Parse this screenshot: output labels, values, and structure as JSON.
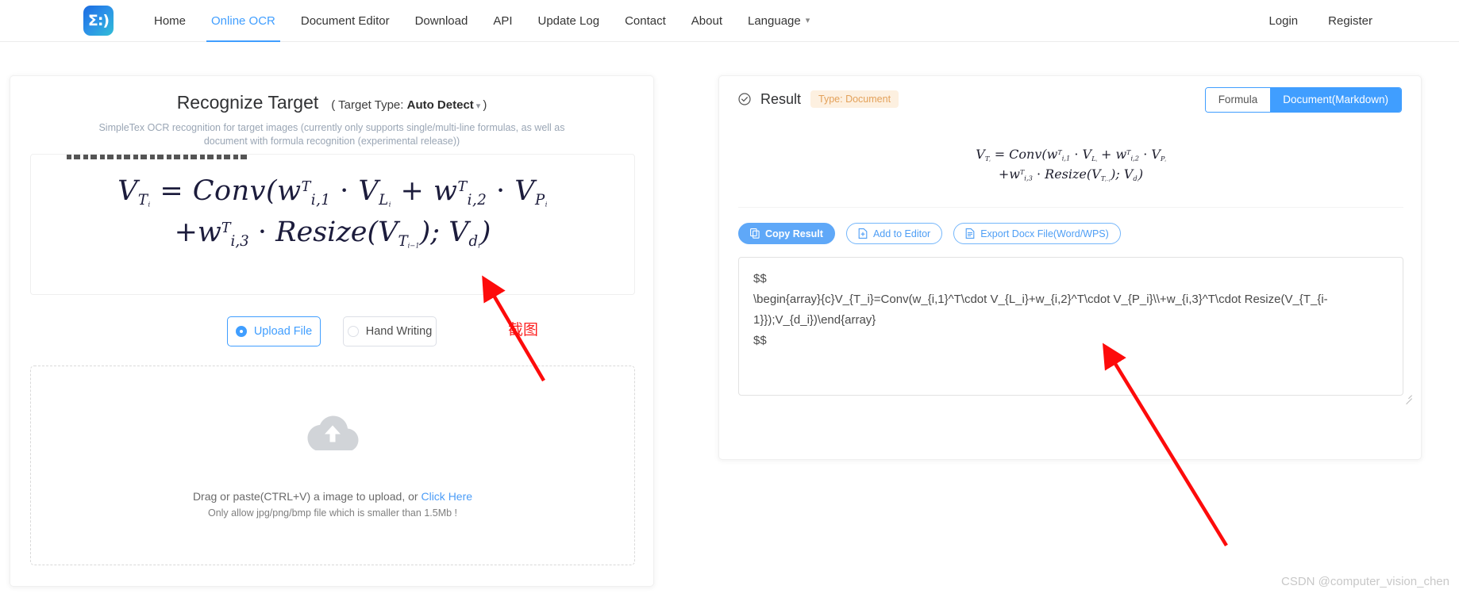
{
  "nav": {
    "logo_text": "Σ:)",
    "links": [
      {
        "label": "Home",
        "active": false
      },
      {
        "label": "Online OCR",
        "active": true
      },
      {
        "label": "Document Editor",
        "active": false
      },
      {
        "label": "Download",
        "active": false
      },
      {
        "label": "API",
        "active": false
      },
      {
        "label": "Update Log",
        "active": false
      },
      {
        "label": "Contact",
        "active": false
      },
      {
        "label": "About",
        "active": false
      }
    ],
    "language_label": "Language",
    "login_label": "Login",
    "register_label": "Register"
  },
  "left_panel": {
    "title": "Recognize Target",
    "target_type_prefix": "( Target Type:",
    "target_type_value": "Auto Detect",
    "target_type_suffix": ")",
    "description": "SimpleTex OCR recognition for target images (currently only supports single/multi-line formulas, as well as document with formula recognition (experimental release))",
    "modes": [
      {
        "label": "Upload File",
        "selected": true
      },
      {
        "label": "Hand Writing",
        "selected": false
      }
    ],
    "annotation": "截图",
    "dropzone": {
      "main_prefix": "Drag or paste(CTRL+V) a image to upload, or ",
      "link": "Click Here",
      "sub": "Only allow jpg/png/bmp file which is smaller than 1.5Mb !"
    }
  },
  "right_panel": {
    "result_label": "Result",
    "type_badge": "Type: Document",
    "tabs": [
      {
        "label": "Formula",
        "active": false
      },
      {
        "label": "Document(Markdown)",
        "active": true
      }
    ],
    "actions": [
      {
        "label": "Copy Result",
        "icon": "copy-icon",
        "primary": true
      },
      {
        "label": "Add to Editor",
        "icon": "file-add-icon",
        "primary": false
      },
      {
        "label": "Export Docx File(Word/WPS)",
        "icon": "document-icon",
        "primary": false
      }
    ],
    "latex_output": "$$\n\\begin{array}{c}V_{T_i}=Conv(w_{i,1}^T\\cdot V_{L_i}+w_{i,2}^T\\cdot V_{P_i}\\\\+w_{i,3}^T\\cdot Resize(V_{T_{i-1}});V_{d_i})\\end{array}\n$$"
  },
  "watermark": "CSDN @computer_vision_chen",
  "colors": {
    "accent": "#409eff",
    "badge_bg": "#fdf0e0",
    "badge_text": "#e3a15a",
    "annotation_red": "#fc1f1f",
    "link_blue": "#4b9cf7"
  }
}
